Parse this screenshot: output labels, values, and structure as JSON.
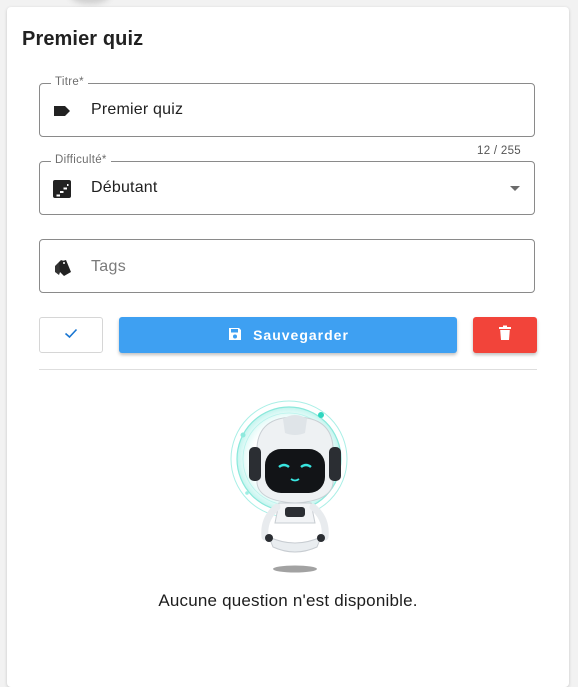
{
  "quiz": {
    "title": "Premier quiz"
  },
  "form": {
    "titre": {
      "label": "Titre*",
      "value": "Premier quiz",
      "counter": "12 / 255",
      "icon": "label-icon"
    },
    "difficulte": {
      "label": "Difficulté*",
      "value": "Débutant",
      "icon": "stairs-icon"
    },
    "tags": {
      "placeholder": "Tags",
      "icon": "tags-icon"
    }
  },
  "actions": {
    "save_label": "Sauvegarder",
    "save_color": "#3ea0f2",
    "delete_color": "#f2443a",
    "check_color": "#1976d2"
  },
  "empty_state": {
    "message": "Aucune question n'est disponible."
  }
}
